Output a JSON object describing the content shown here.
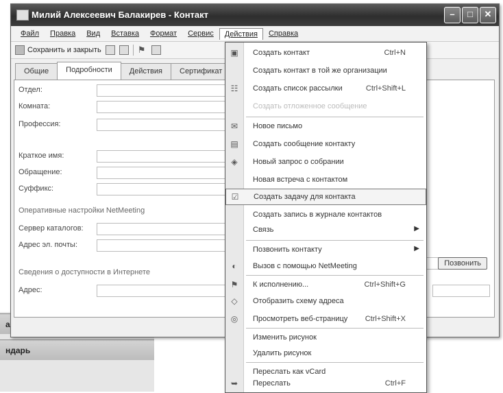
{
  "window": {
    "title": "Милий Алексеевич Балакирев - Контакт",
    "min": "–",
    "max": "□",
    "close": "✕"
  },
  "menu": [
    "Файл",
    "Правка",
    "Вид",
    "Вставка",
    "Формат",
    "Сервис",
    "Действия",
    "Справка"
  ],
  "toolbar": {
    "save_label": "Сохранить и закрыть"
  },
  "tabs": [
    "Общие",
    "Подробности",
    "Действия",
    "Сертификат"
  ],
  "form": {
    "dept": "Отдел:",
    "room": "Комната:",
    "profession": "Профессия:",
    "nickname": "Краткое имя:",
    "salutation": "Обращение:",
    "suffix": "Суффикс:",
    "netmeeting_group": "Оперативные настройки NetMeeting",
    "dir_server": "Сервер каталогов:",
    "email": "Адрес эл. почты:",
    "freebusy_group": "Сведения о доступности в Интернете",
    "address": "Адрес:",
    "call_button": "Позвонить"
  },
  "actions_menu": {
    "items": [
      {
        "label": "Создать контакт",
        "shortcut": "Ctrl+N",
        "icon": "contact-icon"
      },
      {
        "label": "Создать контакт в той же организации",
        "shortcut": "",
        "icon": ""
      },
      {
        "label": "Создать список рассылки",
        "shortcut": "Ctrl+Shift+L",
        "icon": "list-icon"
      },
      {
        "label": "Создать отложенное сообщение",
        "shortcut": "",
        "icon": "",
        "disabled": true
      },
      {
        "label": "Новое письмо",
        "shortcut": "",
        "icon": "mail-icon"
      },
      {
        "label": "Создать сообщение контакту",
        "shortcut": "",
        "icon": "message-icon"
      },
      {
        "label": "Новый запрос о собрании",
        "shortcut": "",
        "icon": "meeting-icon"
      },
      {
        "label": "Новая встреча с контактом",
        "shortcut": "",
        "icon": ""
      },
      {
        "label": "Создать задачу для контакта",
        "shortcut": "",
        "icon": "task-icon",
        "highlight": true
      },
      {
        "label": "Создать запись в журнале контактов",
        "shortcut": "",
        "icon": ""
      },
      {
        "label": "Связь",
        "shortcut": "",
        "icon": "",
        "submenu": true
      },
      {
        "label": "Позвонить контакту",
        "shortcut": "",
        "icon": "",
        "submenu": true
      },
      {
        "label": "Вызов с помощью NetMeeting",
        "shortcut": "",
        "icon": "netmeeting-icon"
      },
      {
        "label": "К исполнению...",
        "shortcut": "Ctrl+Shift+G",
        "icon": "flag-icon"
      },
      {
        "label": "Отобразить схему адреса",
        "shortcut": "",
        "icon": "map-icon"
      },
      {
        "label": "Просмотреть веб-страницу",
        "shortcut": "Ctrl+Shift+X",
        "icon": "web-icon"
      },
      {
        "label": "Изменить рисунок",
        "shortcut": "",
        "icon": ""
      },
      {
        "label": "Удалить рисунок",
        "shortcut": "",
        "icon": ""
      },
      {
        "label": "Переслать как vCard",
        "shortcut": "",
        "icon": ""
      },
      {
        "label": "Переслать",
        "shortcut": "Ctrl+F",
        "icon": "forward-icon"
      }
    ]
  },
  "background": {
    "strip1": "а",
    "strip2": "ндарь"
  }
}
